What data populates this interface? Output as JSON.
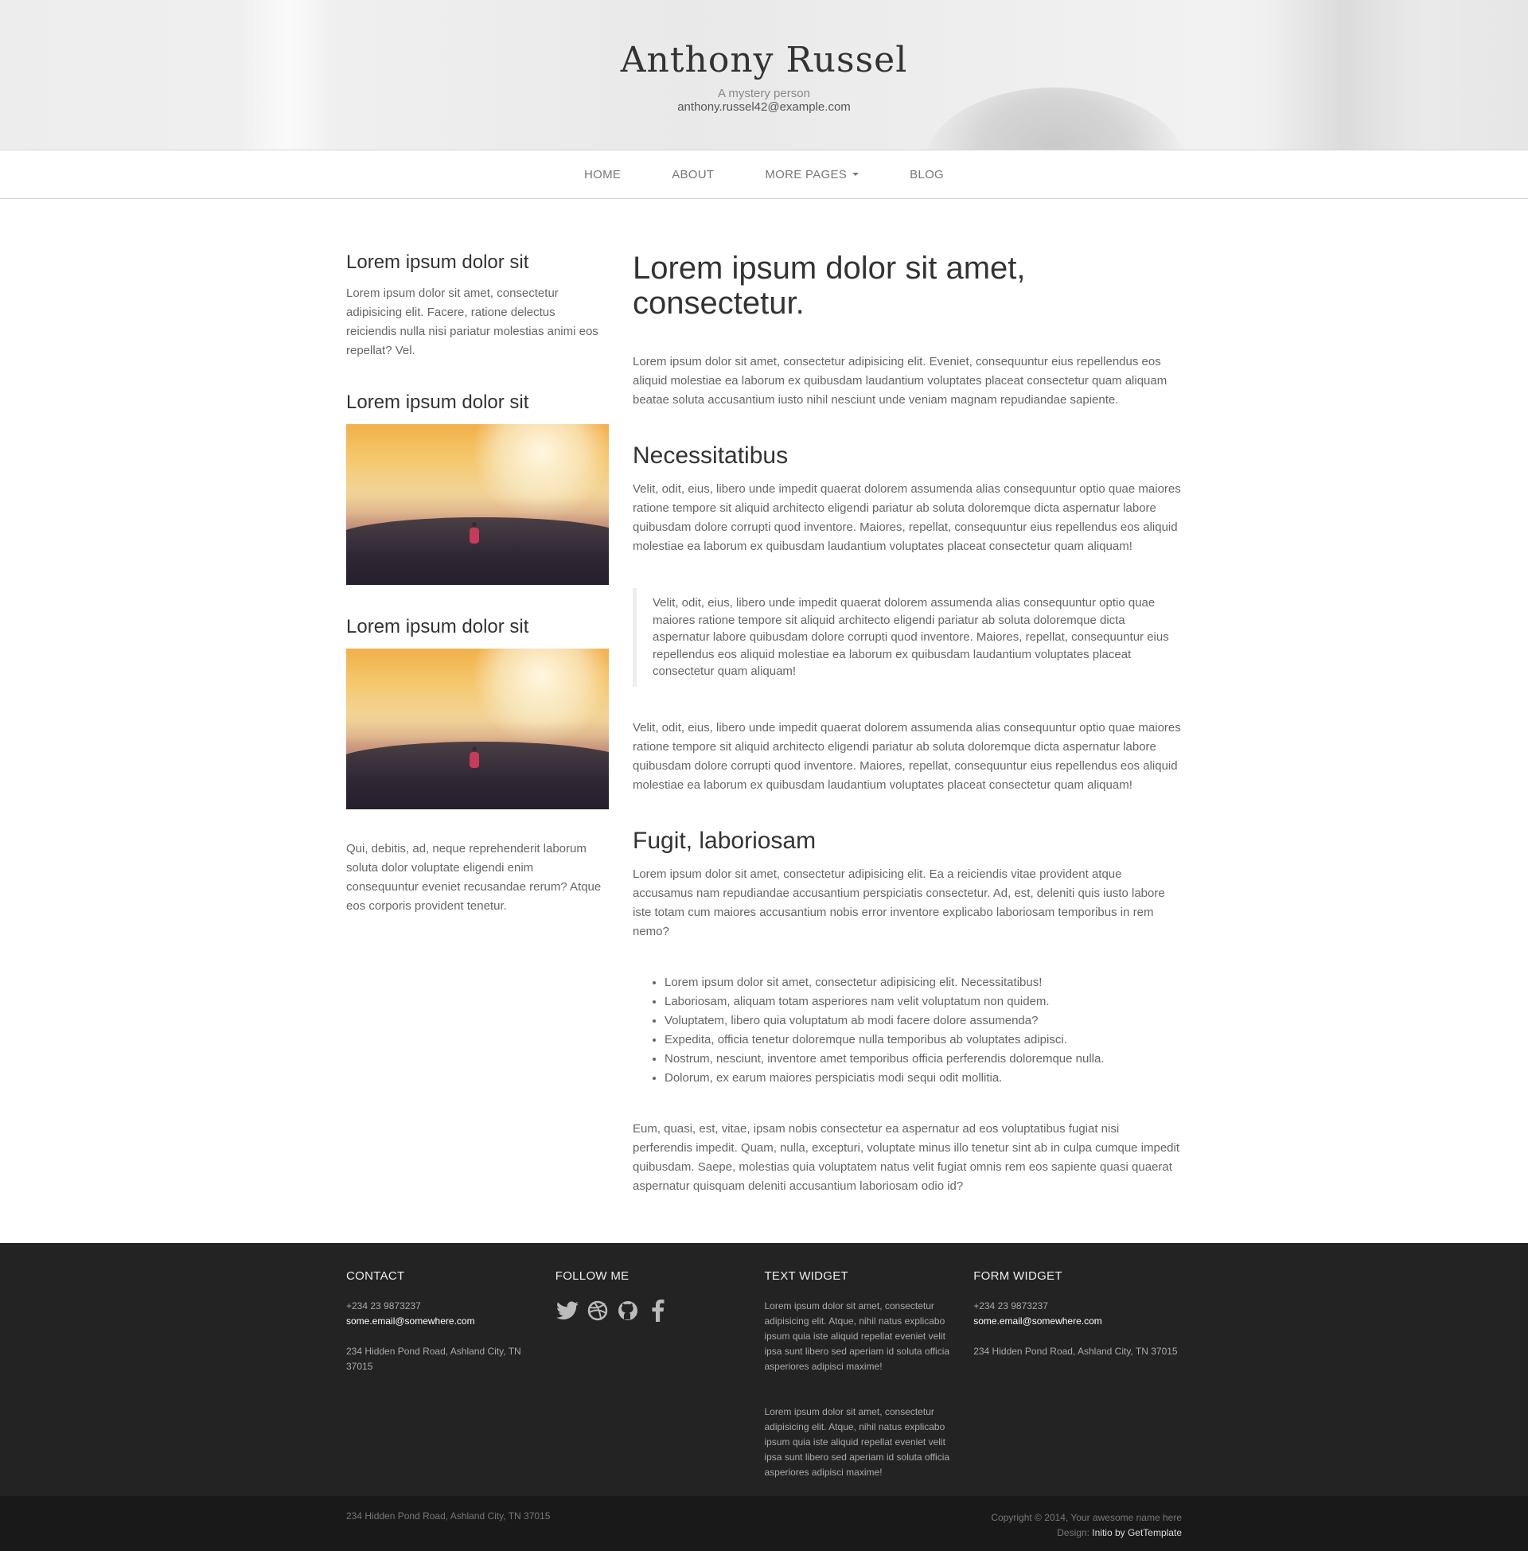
{
  "header": {
    "title": "Anthony Russel",
    "tagline": "A mystery person",
    "email": "anthony.russel42@example.com"
  },
  "nav": {
    "items": [
      "Home",
      "About",
      "More Pages",
      "Blog"
    ]
  },
  "sidebar": {
    "widgets": [
      {
        "title": "Lorem ipsum dolor sit",
        "text": "Lorem ipsum dolor sit amet, consectetur adipisicing elit. Facere, ratione delectus reiciendis nulla nisi pariatur molestias animi eos repellat? Vel."
      },
      {
        "title": "Lorem ipsum dolor sit"
      },
      {
        "title": "Lorem ipsum dolor sit"
      }
    ],
    "closing_text": "Qui, debitis, ad, neque reprehenderit laborum soluta dolor voluptate eligendi enim consequuntur eveniet recusandae rerum? Atque eos corporis provident tenetur."
  },
  "content": {
    "title": "Lorem ipsum dolor sit amet, consectetur.",
    "intro": "Lorem ipsum dolor sit amet, consectetur adipisicing elit. Eveniet, consequuntur eius repellendus eos aliquid molestiae ea laborum ex quibusdam laudantium voluptates placeat consectetur quam aliquam beatae soluta accusantium iusto nihil nesciunt unde veniam magnam repudiandae sapiente.",
    "section1_title": "Necessitatibus",
    "section1_text": "Velit, odit, eius, libero unde impedit quaerat dolorem assumenda alias consequuntur optio quae maiores ratione tempore sit aliquid architecto eligendi pariatur ab soluta doloremque dicta aspernatur labore quibusdam dolore corrupti quod inventore. Maiores, repellat, consequuntur eius repellendus eos aliquid molestiae ea laborum ex quibusdam laudantium voluptates placeat consectetur quam aliquam!",
    "quote": "Velit, odit, eius, libero unde impedit quaerat dolorem assumenda alias consequuntur optio quae maiores ratione tempore sit aliquid architecto eligendi pariatur ab soluta doloremque dicta aspernatur labore quibusdam dolore corrupti quod inventore. Maiores, repellat, consequuntur eius repellendus eos aliquid molestiae ea laborum ex quibusdam laudantium voluptates placeat consectetur quam aliquam!",
    "section1_text2": "Velit, odit, eius, libero unde impedit quaerat dolorem assumenda alias consequuntur optio quae maiores ratione tempore sit aliquid architecto eligendi pariatur ab soluta doloremque dicta aspernatur labore quibusdam dolore corrupti quod inventore. Maiores, repellat, consequuntur eius repellendus eos aliquid molestiae ea laborum ex quibusdam laudantium voluptates placeat consectetur quam aliquam!",
    "section2_title": "Fugit, laboriosam",
    "section2_text": "Lorem ipsum dolor sit amet, consectetur adipisicing elit. Ea a reiciendis vitae provident atque accusamus nam repudiandae accusantium perspiciatis consectetur. Ad, est, deleniti quis iusto labore iste totam cum maiores accusantium nobis error inventore explicabo laboriosam temporibus in rem nemo?",
    "bullets": [
      "Lorem ipsum dolor sit amet, consectetur adipisicing elit. Necessitatibus!",
      "Laboriosam, aliquam totam asperiores nam velit voluptatum non quidem.",
      "Voluptatem, libero quia voluptatum ab modi facere dolore assumenda?",
      "Expedita, officia tenetur doloremque nulla temporibus ab voluptates adipisci.",
      "Nostrum, nesciunt, inventore amet temporibus officia perferendis doloremque nulla.",
      "Dolorum, ex earum maiores perspiciatis modi sequi odit mollitia."
    ],
    "closing": "Eum, quasi, est, vitae, ipsam nobis consectetur ea aspernatur ad eos voluptatibus fugiat nisi perferendis impedit. Quam, nulla, excepturi, voluptate minus illo tenetur sint ab in culpa cumque impedit quibusdam. Saepe, molestias quia voluptatem natus velit fugiat omnis rem eos sapiente quasi quaerat aspernatur quisquam deleniti accusantium laboriosam odio id?"
  },
  "footer": {
    "contact": {
      "title": "Contact",
      "phone": "+234 23 9873237",
      "email": "some.email@somewhere.com",
      "address": "234 Hidden Pond Road, Ashland City, TN 37015"
    },
    "follow": {
      "title": "Follow me",
      "icons": [
        "twitter-icon",
        "dribbble-icon",
        "github-icon",
        "facebook-icon"
      ]
    },
    "text_widget": {
      "title": "Text widget",
      "paragraphs": [
        "Lorem ipsum dolor sit amet, consectetur adipisicing elit. Atque, nihil natus explicabo ipsum quia iste aliquid repellat eveniet velit ipsa sunt libero sed aperiam id soluta officia asperiores adipisci maxime!",
        "Lorem ipsum dolor sit amet, consectetur adipisicing elit. Atque, nihil natus explicabo ipsum quia iste aliquid repellat eveniet velit ipsa sunt libero sed aperiam id soluta officia asperiores adipisci maxime!"
      ]
    },
    "form_widget": {
      "title": "Form widget",
      "phone": "+234 23 9873237",
      "email": "some.email@somewhere.com",
      "address": "234 Hidden Pond Road, Ashland City, TN 37015"
    },
    "bottom": {
      "address": "234 Hidden Pond Road, Ashland City, TN 37015",
      "copyright": "Copyright © 2014, Your awesome name here",
      "design_label": "Design:",
      "design_link": "Initio by GetTemplate"
    }
  }
}
